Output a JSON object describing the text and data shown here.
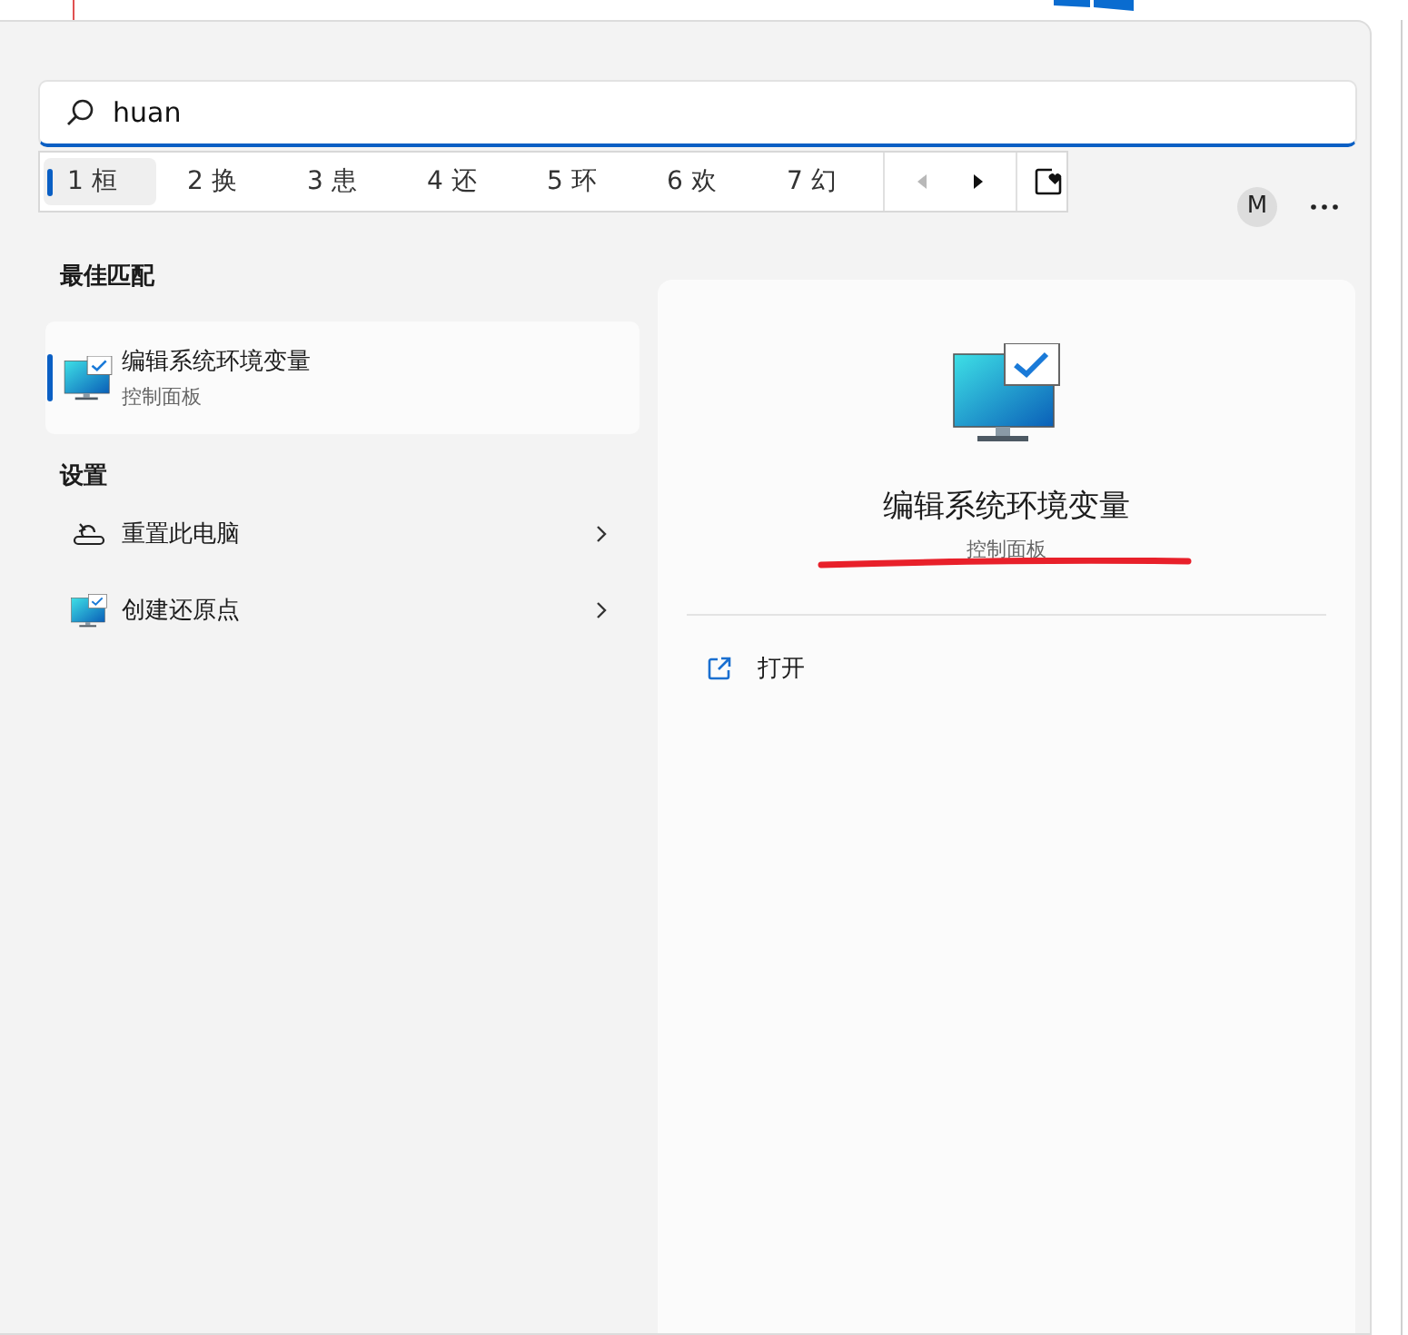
{
  "search": {
    "value": "huan"
  },
  "candidates": [
    {
      "label": "1 桓",
      "selected": true
    },
    {
      "label": "2 换",
      "selected": false
    },
    {
      "label": "3 患",
      "selected": false
    },
    {
      "label": "4 还",
      "selected": false
    },
    {
      "label": "5 环",
      "selected": false
    },
    {
      "label": "6 欢",
      "selected": false
    },
    {
      "label": "7 幻",
      "selected": false
    }
  ],
  "pager": [
    {
      "kind": "prev",
      "disabled": true
    },
    {
      "kind": "next",
      "disabled": false
    }
  ],
  "account": {
    "initial": "M"
  },
  "best_match": {
    "heading": "最佳匹配",
    "item": {
      "title": "编辑系统环境变量",
      "subtitle": "控制面板",
      "selected": true
    }
  },
  "settings": {
    "heading": "设置",
    "items": [
      {
        "kind": "reset",
        "title": "重置此电脑"
      },
      {
        "kind": "monitor",
        "title": "创建还原点"
      }
    ]
  },
  "detail": {
    "title": "编辑系统环境变量",
    "subtitle": "控制面板",
    "actions": [
      {
        "label": "打开"
      }
    ]
  }
}
